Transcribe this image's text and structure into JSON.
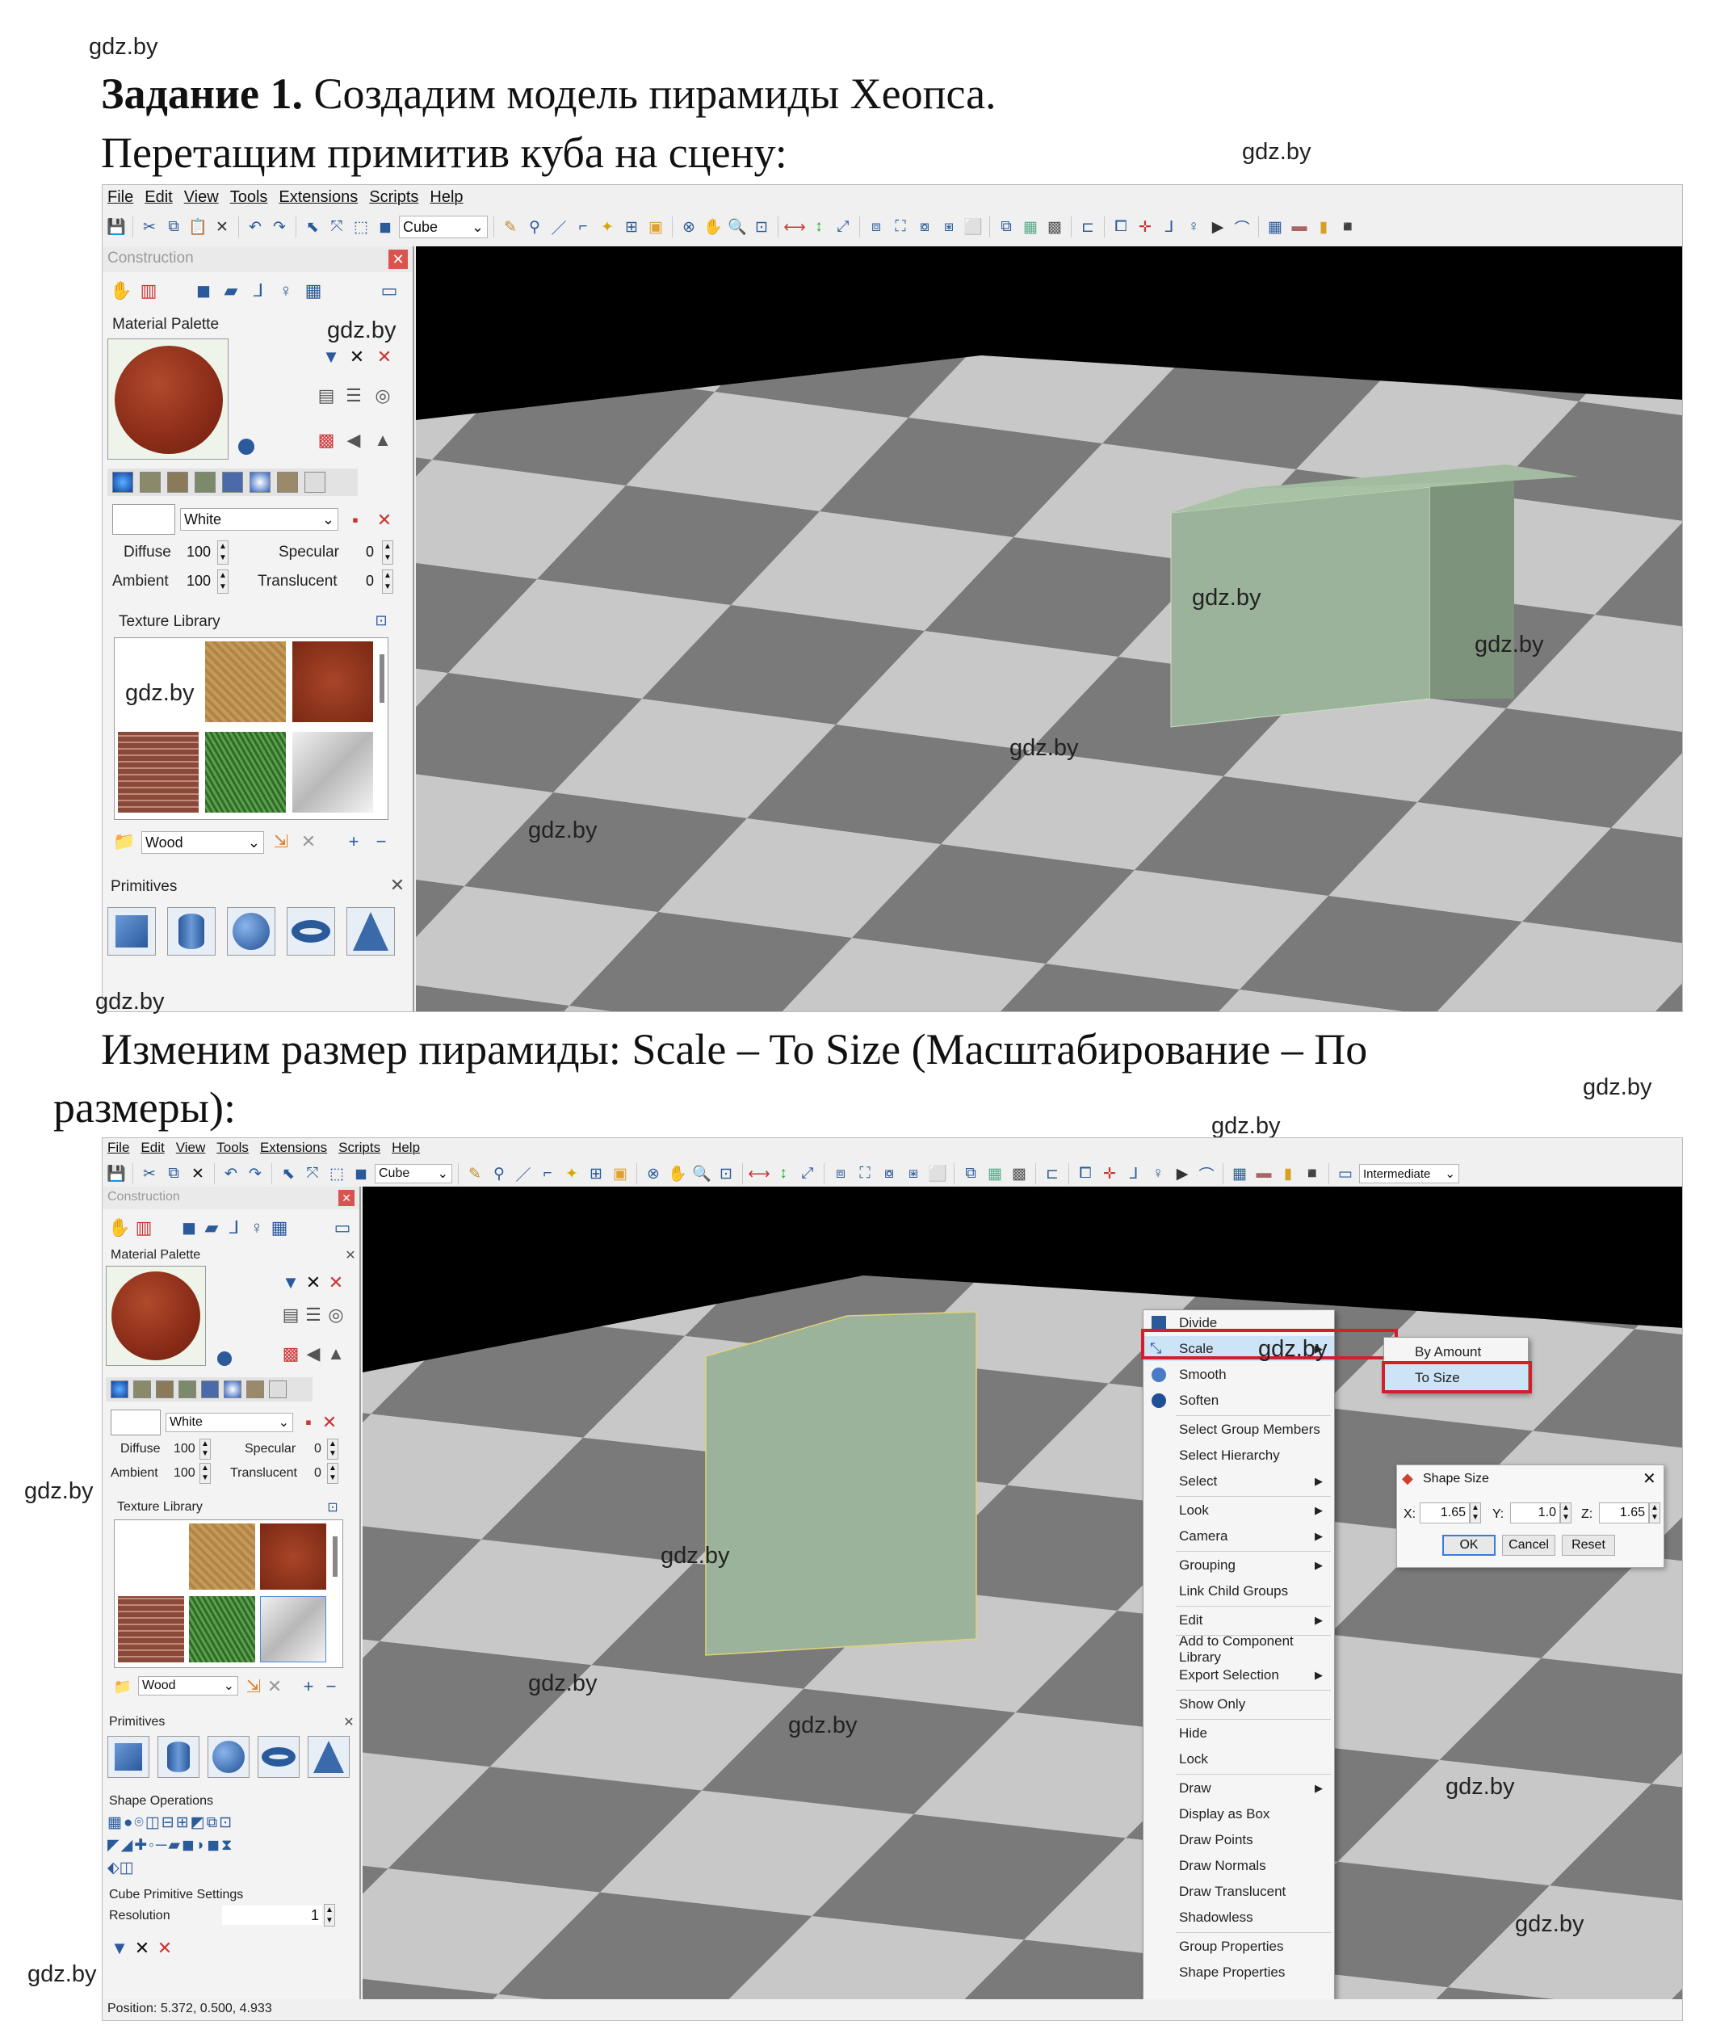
{
  "page": {
    "watermark": "gdz.by",
    "task_label": "Задание 1.",
    "task_text": " Создадим модель пирамиды Хеопса.",
    "line2": "Перетащим примитив куба на сцену:",
    "line3_a": "Изменим  размер  пирамиды:  Scale  –  To  Size  (Масштабирование  –  По",
    "line3_b": "размеры):"
  },
  "app": {
    "menus": [
      "File",
      "Edit",
      "View",
      "Tools",
      "Extensions",
      "Scripts",
      "Help"
    ],
    "shape_combo": "Cube",
    "mode_combo": "Intermediate",
    "panel_title": "Construction",
    "material_palette": "Material Palette",
    "color_name": "White",
    "diffuse_label": "Diffuse",
    "diffuse_value": "100",
    "ambient_label": "Ambient",
    "ambient_value": "100",
    "specular_label": "Specular",
    "specular_value": "0",
    "translucent_label": "Translucent",
    "translucent_value": "0",
    "texture_library": "Texture Library",
    "texture_category": "Wood",
    "primitives": "Primitives",
    "shape_operations": "Shape Operations",
    "cube_settings": "Cube Primitive Settings",
    "resolution_label": "Resolution",
    "resolution_value": "1",
    "status": "Position: 5.372, 0.500, 4.933"
  },
  "context_menu": {
    "items": [
      "Divide",
      "Scale",
      "Smooth",
      "Soften",
      "Select Group Members",
      "Select Hierarchy",
      "Select",
      "Look",
      "Camera",
      "Grouping",
      "Link Child Groups",
      "Edit",
      "Add to Component Library",
      "Export Selection",
      "Show Only",
      "Hide",
      "Lock",
      "Draw",
      "Display as Box",
      "Draw Points",
      "Draw Normals",
      "Draw Translucent",
      "Shadowless",
      "Group Properties",
      "Shape Properties"
    ],
    "submenu": [
      "By Amount",
      "To Size"
    ]
  },
  "dialog": {
    "title": "Shape Size",
    "x_label": "X:",
    "x_value": "1.65",
    "y_label": "Y:",
    "y_value": "1.0",
    "z_label": "Z:",
    "z_value": "1.65",
    "ok": "OK",
    "cancel": "Cancel",
    "reset": "Reset"
  },
  "icons": [
    "save-icon",
    "cut-icon",
    "copy-icon",
    "paste-icon",
    "delete-icon",
    "undo-icon",
    "redo-icon",
    "select-icon",
    "move-icon",
    "cube-icon",
    "hand-icon",
    "zoom-icon",
    "close-icon",
    "cylinder-icon",
    "sphere-icon",
    "torus-icon",
    "cone-icon"
  ],
  "colors": {
    "cube": "#9bb39a",
    "checker_light": "#c8c8c8",
    "checker_dark": "#7a7a7a",
    "highlight": "#d21f2b",
    "menu_hover": "#cde4f7"
  }
}
